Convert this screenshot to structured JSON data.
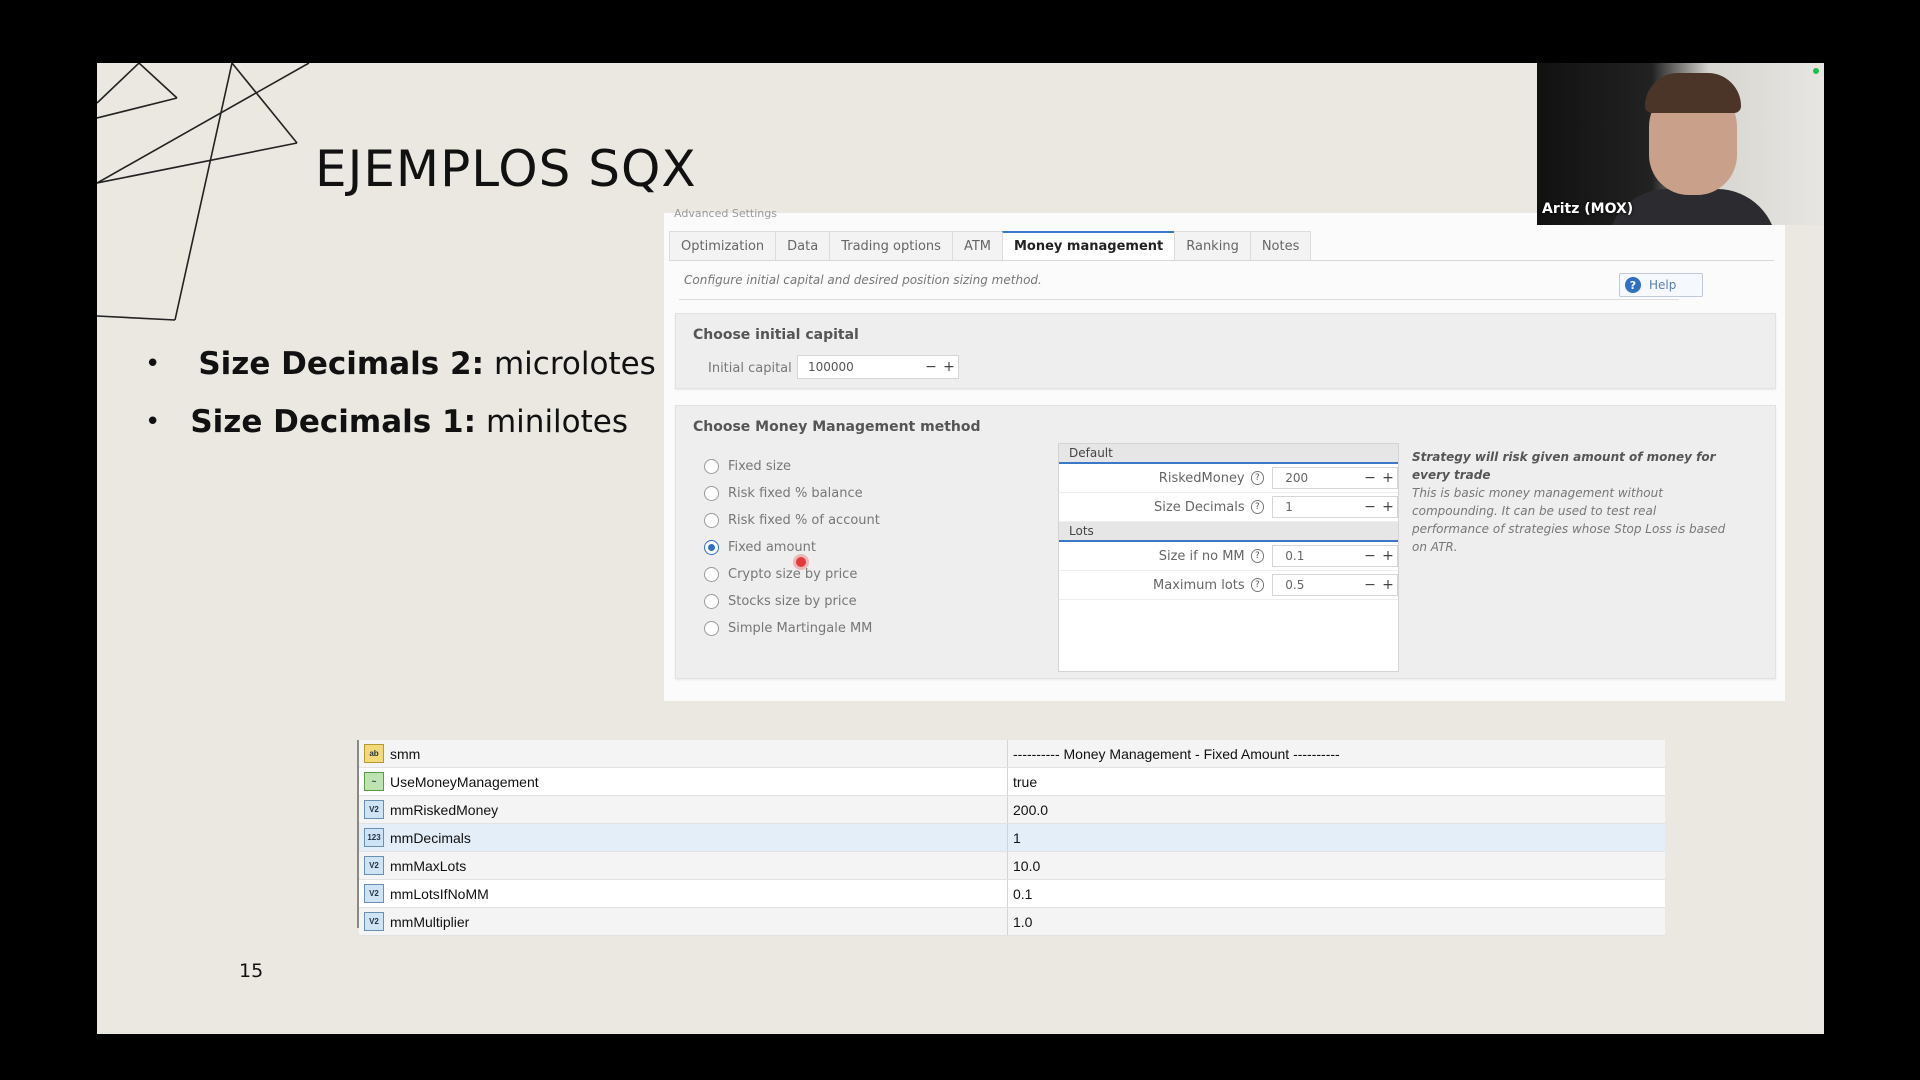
{
  "slide": {
    "title": "EJEMPLOS SQX",
    "bullets": [
      {
        "bold": "Size Decimals 2:",
        "text": "microlotes"
      },
      {
        "bold": "Size Decimals 1:",
        "text": "minilotes"
      }
    ],
    "page_number": "15"
  },
  "webcam": {
    "name": "Aritz (MOX)"
  },
  "sqx": {
    "cut_text": "Advanced Settings",
    "tabs": [
      "Optimization",
      "Data",
      "Trading options",
      "ATM",
      "Money management",
      "Ranking",
      "Notes"
    ],
    "active_tab": "Money management",
    "subtitle": "Configure initial capital and desired position sizing method.",
    "help_label": "Help",
    "initial_capital": {
      "section_title": "Choose initial capital",
      "label": "Initial capital",
      "value": "100000"
    },
    "mm_method": {
      "section_title": "Choose Money Management method",
      "options": [
        "Fixed size",
        "Risk fixed % balance",
        "Risk fixed % of account",
        "Fixed amount",
        "Crypto size by price",
        "Stocks size by price",
        "Simple Martingale MM"
      ],
      "selected": "Fixed amount"
    },
    "params": {
      "group_default": "Default",
      "risked_money_label": "RiskedMoney",
      "risked_money_value": "200",
      "size_decimals_label": "Size Decimals",
      "size_decimals_value": "1",
      "group_lots": "Lots",
      "size_if_no_mm_label": "Size if no MM",
      "size_if_no_mm_value": "0.1",
      "max_lots_label": "Maximum lots",
      "max_lots_value": "0.5"
    },
    "description": {
      "headline": "Strategy will risk given amount of money for every trade",
      "body": "This is basic money management without compounding. It can be used to test real performance of strategies whose Stop Loss is based on ATR."
    }
  },
  "mt4_table": {
    "rows": [
      {
        "icon": "ab",
        "name": "smm",
        "value": "---------- Money Management - Fixed Amount ----------"
      },
      {
        "icon": "bool",
        "name": "UseMoneyManagement",
        "value": "true"
      },
      {
        "icon": "v2",
        "name": "mmRiskedMoney",
        "value": "200.0"
      },
      {
        "icon": "123",
        "name": "mmDecimals",
        "value": "1"
      },
      {
        "icon": "v2",
        "name": "mmMaxLots",
        "value": "10.0"
      },
      {
        "icon": "v2",
        "name": "mmLotsIfNoMM",
        "value": "0.1"
      },
      {
        "icon": "v2",
        "name": "mmMultiplier",
        "value": "1.0"
      }
    ]
  }
}
